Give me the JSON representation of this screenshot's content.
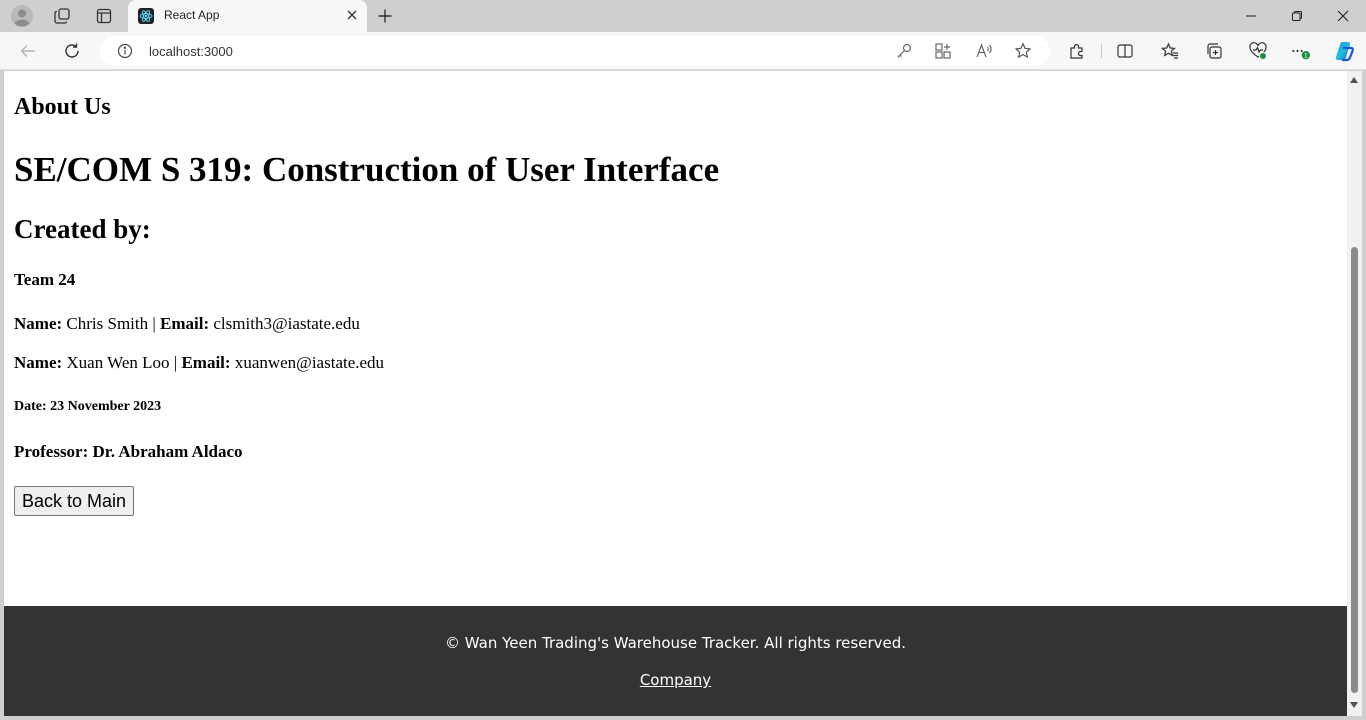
{
  "browser": {
    "tab_title": "React App",
    "url": "localhost:3000",
    "colors": {
      "chrome": "#cfcfcf",
      "toolbar": "#f7f7f7",
      "accent_badge": "#1a8f3a"
    },
    "extensions_badge": "1",
    "icons": [
      "profile-icon",
      "workspaces-icon",
      "tab-actions-icon",
      "react-favicon-icon",
      "close-icon",
      "plus-icon",
      "minimize-icon",
      "restore-icon",
      "window-close-icon",
      "back-icon",
      "refresh-icon",
      "info-icon",
      "key-icon",
      "apps-icon",
      "read-aloud-icon",
      "favorite-star-icon",
      "extensions-icon",
      "split-screen-icon",
      "favorites-icon",
      "collections-icon",
      "browser-essentials-icon",
      "more-icon",
      "copilot-icon"
    ]
  },
  "page": {
    "about_heading": "About Us",
    "course_title": "SE/COM S 319: Construction of User Interface",
    "created_by": "Created by:",
    "team": "Team 24",
    "members": [
      {
        "name_label": "Name:",
        "name": "Chris Smith",
        "sep": "|",
        "email_label": "Email:",
        "email": "clsmith3@iastate.edu"
      },
      {
        "name_label": "Name:",
        "name": "Xuan Wen Loo",
        "sep": "|",
        "email_label": "Email:",
        "email": "xuanwen@iastate.edu"
      }
    ],
    "date": "Date: 23 November 2023",
    "professor": "Professor: Dr. Abraham Aldaco",
    "back_button": "Back to Main",
    "footer": {
      "copyright": "© Wan Yeen Trading's Warehouse Tracker. All rights reserved.",
      "link": "Company",
      "bg_color": "#333333"
    }
  }
}
